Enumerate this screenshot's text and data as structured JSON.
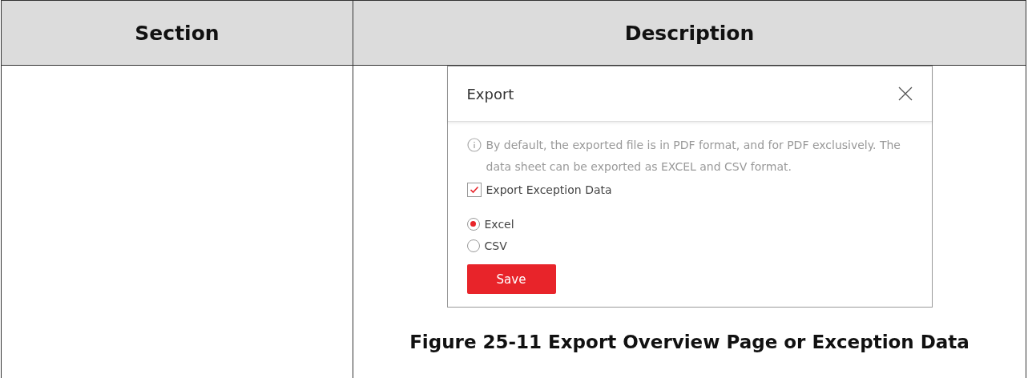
{
  "table": {
    "columns": [
      "Section",
      "Description"
    ],
    "rows": [
      {
        "section": "",
        "dialog": {
          "title": "Export",
          "info": "By default, the exported file is in PDF format, and for PDF exclusively. The data sheet can be exported as EXCEL and CSV format.",
          "checkbox": {
            "label": "Export Exception Data",
            "checked": true
          },
          "options": [
            {
              "label": "Excel",
              "selected": true
            },
            {
              "label": "CSV",
              "selected": false
            }
          ],
          "button": "Save"
        },
        "caption": "Figure 25-11 Export Overview Page or Exception Data"
      }
    ]
  }
}
